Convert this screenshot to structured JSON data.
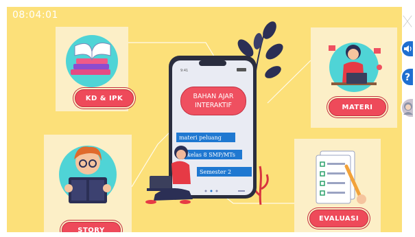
{
  "timer": "08:04:01",
  "phone": {
    "title_line1": "BAHAN AJAR",
    "title_line2": "INTERAKTIF",
    "badges": [
      "materi peluang",
      "kelas 8 SMP/MTs",
      "Semester 2"
    ]
  },
  "menu": {
    "kd_label": "KD & IPK",
    "story_label": "STORY",
    "materi_label": "MATERI",
    "evaluasi_label": "EVALUASI"
  },
  "side_icons": [
    "close-icon",
    "speaker-icon",
    "help-icon",
    "profile-icon"
  ],
  "colors": {
    "background": "#fce079",
    "card": "#fcefc7",
    "pill": "#ee4a5a",
    "badge": "#1f78d1",
    "side_button": "#1f6fd0"
  }
}
